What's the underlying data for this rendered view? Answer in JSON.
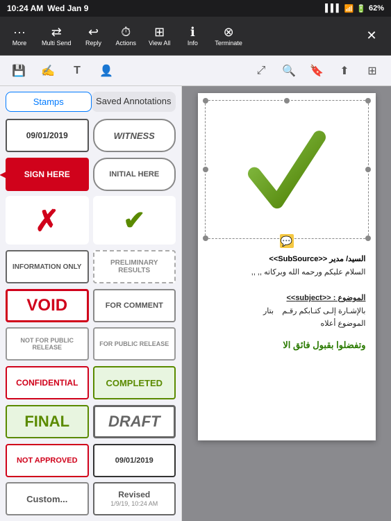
{
  "status_bar": {
    "time": "10:24 AM",
    "day": "Wed Jan 9",
    "battery": "62%",
    "wifi": true,
    "cell": true
  },
  "top_toolbar": {
    "buttons": [
      {
        "id": "more",
        "icon": "···",
        "label": "More"
      },
      {
        "id": "multi-send",
        "icon": "⇶",
        "label": "Multi Send"
      },
      {
        "id": "reply",
        "icon": "↩",
        "label": "Reply"
      },
      {
        "id": "actions",
        "icon": "⏱",
        "label": "Actions"
      },
      {
        "id": "view-all",
        "icon": "⊞",
        "label": "View All"
      },
      {
        "id": "info",
        "icon": "ℹ",
        "label": "Info"
      },
      {
        "id": "terminate",
        "icon": "⊗",
        "label": "Terminate"
      }
    ],
    "close_label": "✕"
  },
  "secondary_toolbar": {
    "left_buttons": [
      "💾",
      "✍",
      "T",
      "👤"
    ],
    "right_buttons": [
      "⤢",
      "🔍",
      "🔖",
      "⬆",
      "⊞"
    ]
  },
  "stamps_panel": {
    "tabs": [
      {
        "id": "stamps",
        "label": "Stamps",
        "active": true
      },
      {
        "id": "saved",
        "label": "Saved Annotations",
        "active": false
      }
    ],
    "stamps": [
      {
        "id": "date1",
        "text": "09/01/2019",
        "style": "date"
      },
      {
        "id": "witness",
        "text": "WITNESS",
        "style": "witness"
      },
      {
        "id": "sign-here",
        "text": "SIGN HERE",
        "style": "sign-here"
      },
      {
        "id": "initial-here",
        "text": "INITIAL HERE",
        "style": "initial-here"
      },
      {
        "id": "x-mark",
        "text": "✗",
        "style": "x-mark"
      },
      {
        "id": "check-mark",
        "text": "✔",
        "style": "check-mark"
      },
      {
        "id": "info-only",
        "text": "INFORMATION ONLY",
        "style": "info-only"
      },
      {
        "id": "prelim",
        "text": "PRELIMINARY RESULTS",
        "style": "prelim"
      },
      {
        "id": "void",
        "text": "VOID",
        "style": "void"
      },
      {
        "id": "for-comment",
        "text": "FOR COMMENT",
        "style": "for-comment"
      },
      {
        "id": "not-public",
        "text": "NOT FOR PUBLIC RELEASE",
        "style": "not-public"
      },
      {
        "id": "for-public",
        "text": "FOR PUBLIC RELEASE",
        "style": "for-public"
      },
      {
        "id": "confidential",
        "text": "CONFIDENTIAL",
        "style": "confidential"
      },
      {
        "id": "completed",
        "text": "COMPLETED",
        "style": "completed"
      },
      {
        "id": "final",
        "text": "FINAL",
        "style": "final"
      },
      {
        "id": "draft",
        "text": "DRAFT",
        "style": "draft"
      },
      {
        "id": "not-approved",
        "text": "NOT APPROVED",
        "style": "not-approved"
      },
      {
        "id": "date2",
        "text": "09/01/2019",
        "style": "date2"
      },
      {
        "id": "custom",
        "text": "Custom...",
        "style": "custom"
      },
      {
        "id": "revised",
        "text": "Revised",
        "subtext": "1/9/19, 10:24 AM",
        "style": "revised"
      }
    ]
  },
  "document": {
    "checkmark_visible": true,
    "note_icon": "📌",
    "text_lines": [
      {
        "type": "sender",
        "content": "السيد/ مدير <<SubSource>>"
      },
      {
        "type": "normal",
        "content": "السلام عليكم ورحمه الله وبركاته ,, ,,"
      },
      {
        "type": "normal",
        "content": ""
      },
      {
        "type": "subject",
        "content": "الموضوع : <<subject>>"
      },
      {
        "type": "normal",
        "content": "بالإشـارة إلـى كتـابكم رقـم بتار"
      },
      {
        "type": "normal",
        "content": "الموضوع أعلاه"
      },
      {
        "type": "green",
        "content": "وتفضلوا بقبول فائق الا"
      }
    ]
  }
}
